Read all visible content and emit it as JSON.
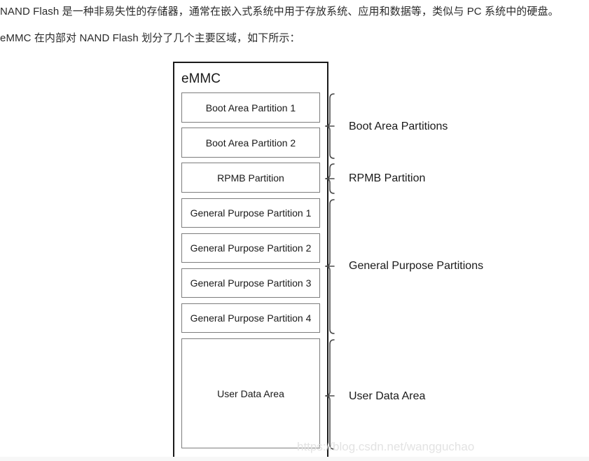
{
  "page": {
    "background_color": "#ffffff",
    "text_color": "#2b2b2b",
    "diagram_stroke_color": "#1a1a1a",
    "inner_box_stroke_color": "#7d7d7d",
    "watermark_color": "#e3e3e3"
  },
  "paragraphs": [
    "NAND Flash 是一种非易失性的存储器，通常在嵌入式系统中用于存放系统、应用和数据等，类似与 PC 系统中的硬盘。",
    "eMMC 在内部对 NAND Flash 划分了几个主要区域，如下所示："
  ],
  "diagram": {
    "container_title": "eMMC",
    "partitions": [
      {
        "label": "Boot Area Partition 1"
      },
      {
        "label": "Boot Area Partition 2"
      },
      {
        "label": "RPMB Partition"
      },
      {
        "label": "General Purpose Partition 1"
      },
      {
        "label": "General Purpose Partition 2"
      },
      {
        "label": "General Purpose Partition 3"
      },
      {
        "label": "General Purpose Partition 4"
      },
      {
        "label": "User Data Area"
      }
    ],
    "group_labels": [
      {
        "label": "Boot Area Partitions"
      },
      {
        "label": "RPMB Partition"
      },
      {
        "label": "General Purpose Partitions"
      },
      {
        "label": "User Data Area"
      }
    ]
  },
  "watermark": "https://blog.csdn.net/wangguchao"
}
